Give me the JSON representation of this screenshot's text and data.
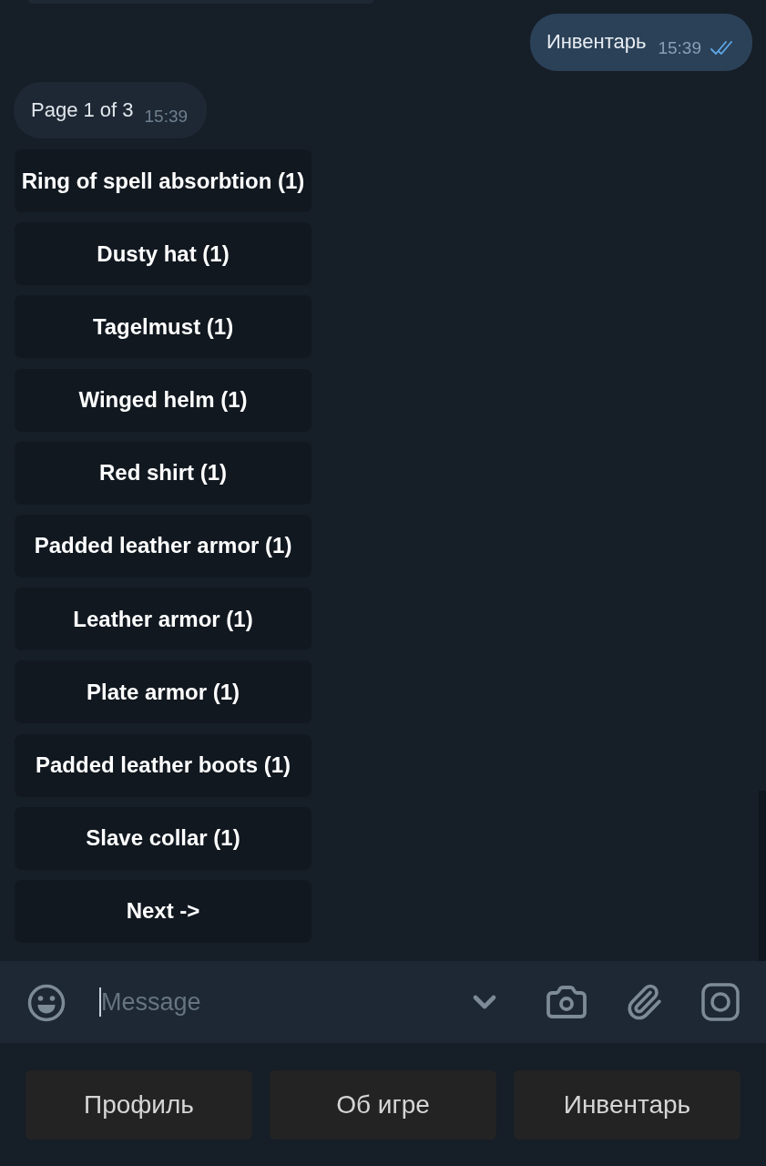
{
  "messages": [
    {
      "kind": "outgoing",
      "text": "Инвентарь",
      "time": "15:39",
      "read": true
    },
    {
      "kind": "incoming",
      "text": "Page 1 of 3",
      "time": "15:39"
    }
  ],
  "inline_keyboard": [
    "Ring of spell absorbtion (1)",
    "Dusty hat (1)",
    "Tagelmust (1)",
    "Winged helm (1)",
    "Red shirt (1)",
    "Padded leather armor (1)",
    "Leather armor (1)",
    "Plate armor (1)",
    "Padded leather boots (1)",
    "Slave collar (1)",
    "Next ->"
  ],
  "composer": {
    "placeholder": "Message",
    "focused": true
  },
  "reply_keyboard": [
    "Профиль",
    "Об игре",
    "Инвентарь"
  ]
}
